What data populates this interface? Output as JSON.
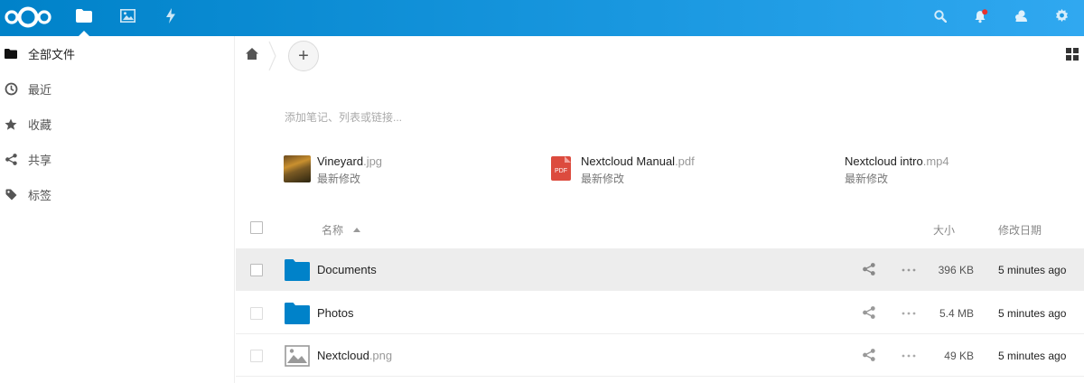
{
  "header": {
    "apps": [
      {
        "icon": "files-folder-icon",
        "active": true
      },
      {
        "icon": "photos-icon",
        "active": false
      },
      {
        "icon": "activity-icon",
        "active": false
      }
    ],
    "right_icons": [
      "search-icon",
      "notifications-icon",
      "contacts-icon",
      "settings-gear-icon"
    ],
    "accent": "#0082c9"
  },
  "sidebar": {
    "items": [
      {
        "label": "全部文件",
        "icon": "folder-icon",
        "active": true
      },
      {
        "label": "最近",
        "icon": "clock-icon",
        "active": false
      },
      {
        "label": "收藏",
        "icon": "star-icon",
        "active": false
      },
      {
        "label": "共享",
        "icon": "share-icon",
        "active": false
      },
      {
        "label": "标签",
        "icon": "tag-icon",
        "active": false
      }
    ]
  },
  "controls": {
    "new_button_label": "+"
  },
  "rich_workspace": {
    "placeholder": "添加笔记、列表或链接..."
  },
  "recent": [
    {
      "base": "Vineyard",
      "ext": ".jpg",
      "sub": "最新修改",
      "icon": "image-thumbnail-icon"
    },
    {
      "base": "Nextcloud Manual",
      "ext": ".pdf",
      "sub": "最新修改",
      "icon": "pdf-icon",
      "icon_label": "PDF"
    },
    {
      "base": "Nextcloud intro",
      "ext": ".mp4",
      "sub": "最新修改",
      "icon": "video-icon"
    }
  ],
  "table": {
    "columns": {
      "name": "名称",
      "size": "大小",
      "modified": "修改日期"
    },
    "sort": "name-ascending",
    "rows": [
      {
        "base": "Documents",
        "ext": "",
        "type": "folder",
        "size": "396 KB",
        "modified": "5 minutes ago",
        "highlighted": true
      },
      {
        "base": "Photos",
        "ext": "",
        "type": "folder",
        "size": "5.4 MB",
        "modified": "5 minutes ago",
        "highlighted": false
      },
      {
        "base": "Nextcloud",
        "ext": ".png",
        "type": "image",
        "size": "49 KB",
        "modified": "5 minutes ago",
        "highlighted": false
      }
    ]
  }
}
